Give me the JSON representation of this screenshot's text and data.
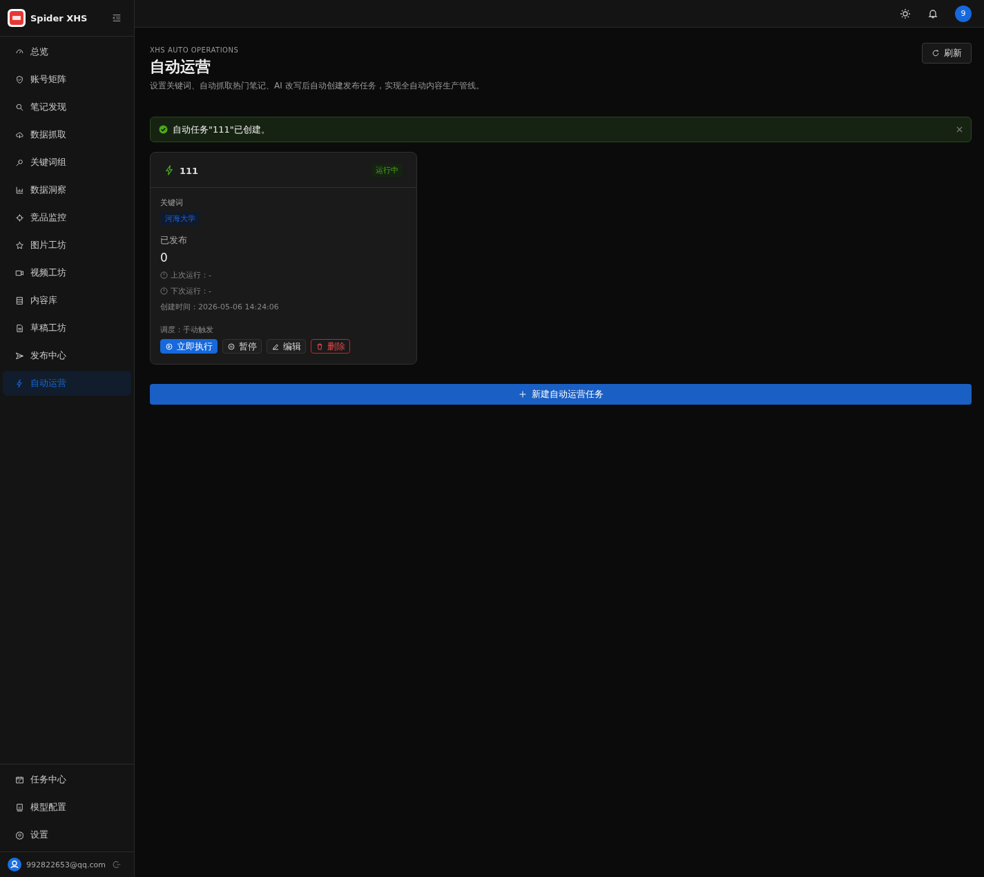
{
  "app": {
    "name": "Spider XHS"
  },
  "sidebar": {
    "items": [
      {
        "label": "总览",
        "selected": false
      },
      {
        "label": "账号矩阵",
        "selected": false
      },
      {
        "label": "笔记发现",
        "selected": false
      },
      {
        "label": "数据抓取",
        "selected": false
      },
      {
        "label": "关键词组",
        "selected": false
      },
      {
        "label": "数据洞察",
        "selected": false
      },
      {
        "label": "竞品监控",
        "selected": false
      },
      {
        "label": "图片工坊",
        "selected": false
      },
      {
        "label": "视频工坊",
        "selected": false
      },
      {
        "label": "内容库",
        "selected": false
      },
      {
        "label": "草稿工坊",
        "selected": false
      },
      {
        "label": "发布中心",
        "selected": false
      },
      {
        "label": "自动运营",
        "selected": true
      }
    ],
    "bottom_items": [
      {
        "label": "任务中心",
        "selected": false
      },
      {
        "label": "模型配置",
        "selected": false
      },
      {
        "label": "设置",
        "selected": false
      }
    ],
    "user": {
      "email": "992822653@qq.com"
    }
  },
  "topbar": {
    "avatar": "9"
  },
  "page": {
    "eyebrow": "XHS AUTO OPERATIONS",
    "title": "自动运营",
    "subtitle": "设置关键词、自动抓取热门笔记、AI 改写后自动创建发布任务，实现全自动内容生产管线。",
    "refresh_button": "刷新"
  },
  "alert": {
    "message": "自动任务\"111\"已创建。"
  },
  "tasks": [
    {
      "name": "111",
      "status": "运行中",
      "running": true,
      "keywords_label": "关键词",
      "keywords": [
        "河海大学"
      ],
      "published_label": "已发布",
      "published": "0",
      "last_run": "上次运行：-",
      "next_run": "下次运行：-",
      "created": "创建时间：2026-05-06 14:24:06",
      "schedule": "调度：手动触发",
      "actions": [
        {
          "label": "立即执行",
          "kind": "primary"
        },
        {
          "label": "暂停",
          "kind": "default"
        },
        {
          "label": "编辑",
          "kind": "default"
        },
        {
          "label": "删除",
          "kind": "danger"
        }
      ]
    }
  ],
  "new_task_button": "新建自动运营任务"
}
